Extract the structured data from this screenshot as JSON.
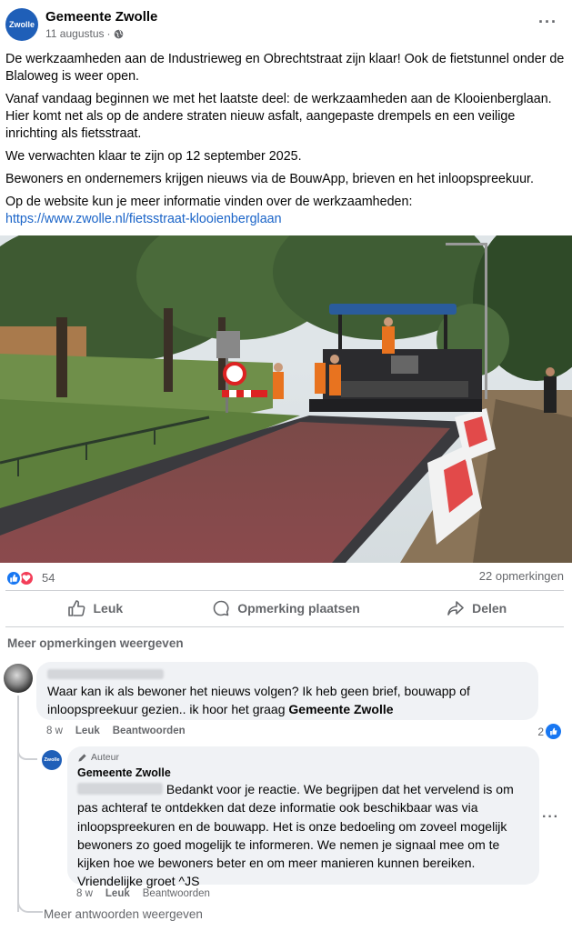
{
  "post": {
    "page_name": "Gemeente Zwolle",
    "avatar_text": "Zwolle",
    "date": "11 augustus",
    "date_separator": "·",
    "more_label": "···",
    "paragraphs": [
      "De werkzaamheden aan de Industrieweg en Obrechtstraat zijn klaar! Ook de fietstunnel onder de Blaloweg is weer open.",
      "Vanaf vandaag beginnen we met het laatste deel: de werkzaamheden aan de Klooienberglaan. Hier komt net als op de andere straten nieuw asfalt, aangepaste drempels en een veilige inrichting als fietsstraat.",
      "We verwachten klaar te zijn op 12 september 2025.",
      "Bewoners en ondernemers krijgen nieuws via de BouwApp, brieven en het inloopspreekuur."
    ],
    "link_intro": "Op de website kun je meer informatie vinden over de werkzaamheden:",
    "link_url": "https://www.zwolle.nl/fietsstraat-klooienberglaan"
  },
  "reactions": {
    "count": "54",
    "comments": "22 opmerkingen"
  },
  "actions": {
    "like": "Leuk",
    "comment": "Opmerking plaatsen",
    "share": "Delen"
  },
  "more_comments": "Meer opmerkingen weergeven",
  "comment1": {
    "text": "Waar kan ik als bewoner het nieuws volgen? Ik heb geen brief, bouwapp of inloopspreekuur gezien.. ik hoor het graag ",
    "mention": "Gemeente Zwolle",
    "age": "8 w",
    "like": "Leuk",
    "reply": "Beantwoorden",
    "likes": "2"
  },
  "reply1": {
    "author_badge": "Auteur",
    "name": "Gemeente Zwolle",
    "avatar_text": "Zwolle",
    "text": " Bedankt voor je reactie. We begrijpen dat het vervelend is om pas achteraf te ontdekken dat deze informatie ook beschikbaar was via inloopspreekuren en de bouwapp. Het is onze bedoeling om zoveel mogelijk bewoners zo goed mogelijk te informeren. We nemen je signaal mee om te kijken hoe we bewoners beter en om meer manieren kunnen bereiken. Vriendelijke groet ^JS",
    "age": "8 w",
    "like": "Leuk",
    "reply": "Beantwoorden",
    "more": "···"
  },
  "more_replies": "Meer antwoorden weergeven"
}
